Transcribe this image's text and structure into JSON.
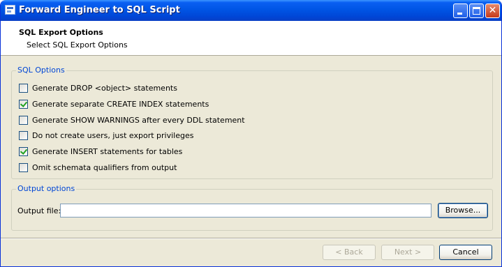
{
  "window": {
    "title": "Forward Engineer to SQL Script"
  },
  "header": {
    "title": "SQL Export Options",
    "subtitle": "Select SQL Export Options"
  },
  "sql_options": {
    "legend": "SQL Options",
    "items": [
      {
        "label": "Generate DROP <object> statements",
        "checked": false
      },
      {
        "label": "Generate separate CREATE INDEX statements",
        "checked": true
      },
      {
        "label": "Generate SHOW WARNINGS after every DDL statement",
        "checked": false
      },
      {
        "label": "Do not create users, just export privileges",
        "checked": false
      },
      {
        "label": "Generate INSERT statements for tables",
        "checked": true
      },
      {
        "label": "Omit schemata qualifiers from output",
        "checked": false
      }
    ]
  },
  "output_options": {
    "legend": "Output options",
    "file_label": "Output file:",
    "file_value": "",
    "browse_label": "Browse..."
  },
  "footer": {
    "back_label": "< Back",
    "next_label": "Next >",
    "cancel_label": "Cancel"
  },
  "colors": {
    "titlebar": "#0055e5",
    "legend_text": "#0046d5",
    "dialog_bg": "#ece9d8",
    "check_mark": "#21a121"
  },
  "icons": {
    "app": "window-app-icon",
    "minimize": "minimize-icon",
    "maximize": "maximize-icon",
    "close": "close-icon"
  }
}
